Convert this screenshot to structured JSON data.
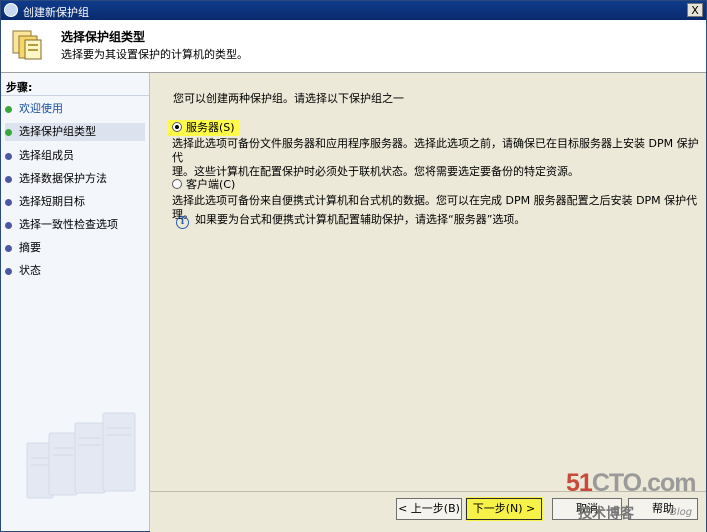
{
  "window": {
    "title": "创建新保护组",
    "close_label": "X"
  },
  "header": {
    "title": "选择保护组类型",
    "subtitle": "选择要为其设置保护的计算机的类型。"
  },
  "steps": {
    "title": "步骤:",
    "items": [
      {
        "label": "欢迎使用"
      },
      {
        "label": "选择保护组类型"
      },
      {
        "label": "选择组成员"
      },
      {
        "label": "选择数据保护方法"
      },
      {
        "label": "选择短期目标"
      },
      {
        "label": "选择一致性检查选项"
      },
      {
        "label": "摘要"
      },
      {
        "label": "状态"
      }
    ]
  },
  "main": {
    "intro": "您可以创建两种保护组。请选择以下保护组之一",
    "server_option": {
      "label": "服务器(S)",
      "selected": true,
      "description_line1": "选择此选项可备份文件服务器和应用程序服务器。选择此选项之前，请确保已在目标服务器上安装 DPM 保护代",
      "description_line2": "理。这些计算机在配置保护时必须处于联机状态。您将需要选定要备份的特定资源。"
    },
    "client_option": {
      "label": "客户端(C)",
      "selected": false,
      "description": "选择此选项可备份来自便携式计算机和台式机的数据。您可以在完成 DPM 服务器配置之后安装 DPM 保护代理。"
    },
    "info_text": "如果要为台式和便携式计算机配置辅助保护，请选择“服务器”选项。"
  },
  "buttons": {
    "back": "< 上一步(B)",
    "next": "下一步(N) >",
    "cancel": "取消",
    "help": "帮助"
  },
  "watermark": {
    "line1_red": "51",
    "line1_gray": "CTO.com",
    "line2": "技术博客",
    "line3": "Blog"
  },
  "colors": {
    "highlight": "#fffb4a",
    "titlebar": "#0f3b8c",
    "accent_dot": "#4a58a6",
    "done_dot": "#38a838"
  }
}
